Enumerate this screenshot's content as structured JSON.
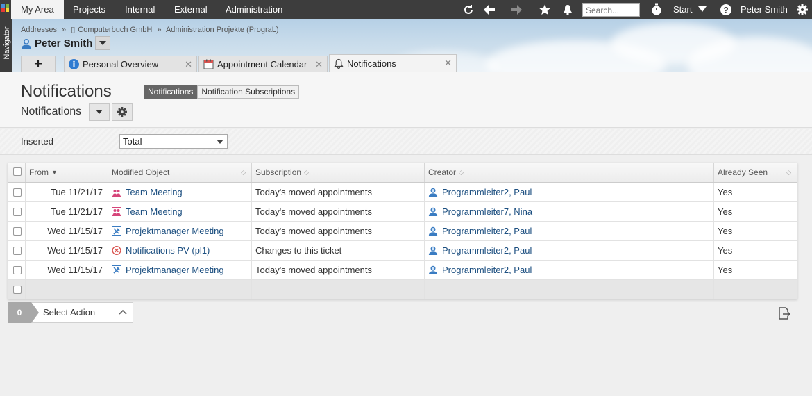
{
  "topnav": {
    "items": [
      "My Area",
      "Projects",
      "Internal",
      "External",
      "Administration"
    ],
    "active": "My Area",
    "search_placeholder": "Search...",
    "start_label": "Start",
    "user_name": "Peter Smith",
    "icons": [
      "refresh-icon",
      "back-arrow-icon",
      "forward-arrow-icon",
      "star-icon",
      "bell-icon",
      "stopwatch-icon",
      "help-icon",
      "gear-icon"
    ]
  },
  "navigator_label": "Navigator",
  "breadcrumb": {
    "items": [
      "Addresses",
      "Computerbuch GmbH",
      "Administration Projekte (PrograL)"
    ],
    "separator": "»"
  },
  "person": {
    "name": "Peter Smith"
  },
  "tabs": [
    {
      "label": "Personal Overview",
      "icon": "info-icon"
    },
    {
      "label": "Appointment Calendar",
      "icon": "calendar-icon"
    },
    {
      "label": "Notifications",
      "icon": "bell-outline-icon"
    }
  ],
  "page": {
    "title": "Notifications",
    "views": [
      "Notifications",
      "Notification Subscriptions"
    ],
    "active_view": "Notifications",
    "subtitle": "Notifications"
  },
  "filter": {
    "label": "Inserted",
    "value": "Total"
  },
  "grid": {
    "columns": [
      "From",
      "Modified Object",
      "Subscription",
      "Creator",
      "Already Seen"
    ],
    "rows": [
      {
        "from": "Tue 11/21/17",
        "object": "Team Meeting",
        "object_icon": "meeting-icon",
        "subscription": "Today's moved appointments",
        "creator": "Programmleiter2, Paul",
        "seen": "Yes"
      },
      {
        "from": "Tue 11/21/17",
        "object": "Team Meeting",
        "object_icon": "meeting-icon",
        "subscription": "Today's moved appointments",
        "creator": "Programmleiter7, Nina",
        "seen": "Yes"
      },
      {
        "from": "Wed 11/15/17",
        "object": "Projektmanager Meeting",
        "object_icon": "tools-icon",
        "subscription": "Today's moved appointments",
        "creator": "Programmleiter2, Paul",
        "seen": "Yes"
      },
      {
        "from": "Wed 11/15/17",
        "object": "Notifications PV (pl1)",
        "object_icon": "ticket-error-icon",
        "subscription": "Changes to this ticket",
        "creator": "Programmleiter2, Paul",
        "seen": "Yes"
      },
      {
        "from": "Wed 11/15/17",
        "object": "Projektmanager Meeting",
        "object_icon": "tools-icon",
        "subscription": "Today's moved appointments",
        "creator": "Programmleiter2, Paul",
        "seen": "Yes"
      }
    ]
  },
  "actions": {
    "selected_count": "0",
    "label": "Select Action"
  },
  "colors": {
    "topbar": "#3d3d3d",
    "link": "#1c4f80",
    "active_pill": "#666666"
  }
}
